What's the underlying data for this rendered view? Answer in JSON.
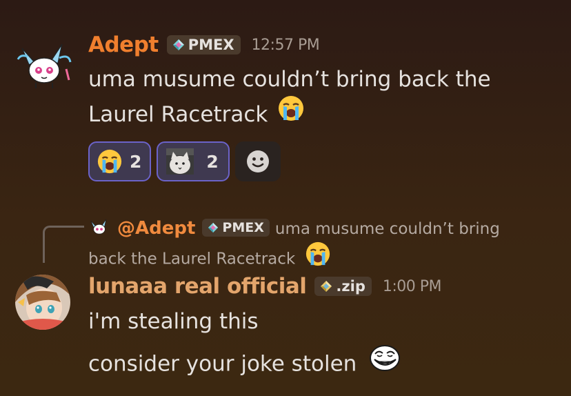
{
  "message1": {
    "username": "Adept",
    "username_color": "#f07f2e",
    "tag_label": "PMEX",
    "tag_icon": "diamond-icon",
    "timestamp": "12:57 PM",
    "line1": "uma musume couldn’t bring back the",
    "line2": "Laurel Racetrack",
    "inline_emoji": "loudly-crying-emoji",
    "reactions": [
      {
        "emoji": "loudly-crying-emoji",
        "count": "2"
      },
      {
        "emoji": "cat-photo-emoji",
        "count": "2"
      }
    ],
    "add_reaction_icon": "smiley-icon"
  },
  "reply": {
    "mention": "@Adept",
    "tag_label": "PMEX",
    "preview_line1": "uma musume couldn’t bring",
    "preview_line2": "back the Laurel Racetrack"
  },
  "message2": {
    "username": "lunaaa real official",
    "username_color": "#e3a56c",
    "tag_label": ".zip",
    "tag_icon": "diamond-icon",
    "timestamp": "1:00 PM",
    "line1": "i'm stealing this",
    "line2": "consider your joke stolen",
    "inline_emoji": "troll-face-emoji"
  }
}
